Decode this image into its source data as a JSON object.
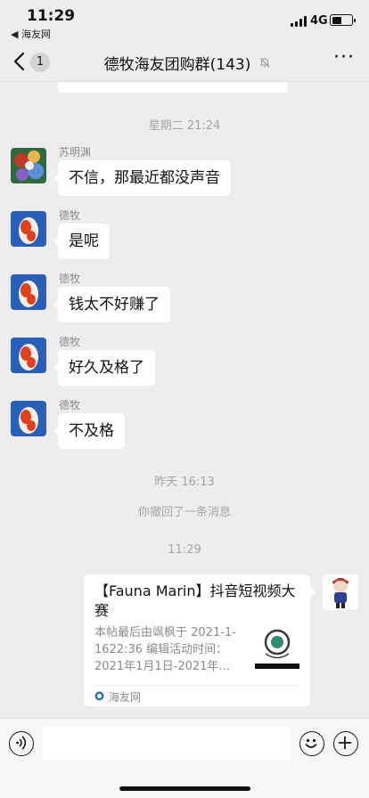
{
  "status_bar": {
    "time": "11:29",
    "back_app": "◀ 海友网",
    "network": "4G",
    "battery_level": 0.5
  },
  "nav": {
    "unread_count": "1",
    "title": "德牧海友团购群(143)"
  },
  "chat": {
    "timestamp_1": "星期二 21:24",
    "messages": [
      {
        "sender": "苏明渊",
        "text": "不信，那最近都没声音"
      },
      {
        "sender": "德牧",
        "text": "是呢"
      },
      {
        "sender": "德牧",
        "text": "钱太不好赚了"
      },
      {
        "sender": "德牧",
        "text": "好久及格了"
      },
      {
        "sender": "德牧",
        "text": "不及格"
      }
    ],
    "timestamp_2": "昨天 16:13",
    "recall_notice": "你撤回了一条消息",
    "timestamp_3": "11:29",
    "link_card": {
      "title": "【Fauna Marin】抖音短视频大赛",
      "description": "本帖最后由飒枫于 2021-1-1622:36 编辑活动时间：2021年1月1日-2021年...",
      "source": "海友网"
    }
  },
  "colors": {
    "background": "#ededed",
    "bubble": "#ffffff",
    "meta_text": "#a6a6a6"
  }
}
